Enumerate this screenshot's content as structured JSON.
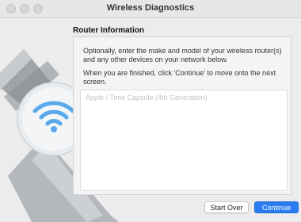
{
  "window": {
    "title": "Wireless Diagnostics"
  },
  "section": {
    "title": "Router Information"
  },
  "instructions": {
    "line1": "Optionally, enter the make and model of your wireless router(s) and any other devices on your network below.",
    "line2": "When you are finished, click 'Continue' to move onto the next screen."
  },
  "device_field": {
    "value": "",
    "placeholder": "Apple / Time Capsule (4th Generation)"
  },
  "buttons": {
    "start_over": "Start Over",
    "continue": "Continue"
  },
  "colors": {
    "accent": "#2a7cf0",
    "wifi_icon": "#5aa9ec"
  },
  "icons": {
    "hero": "wifi-icon",
    "background_tool": "screwdriver-icon"
  }
}
